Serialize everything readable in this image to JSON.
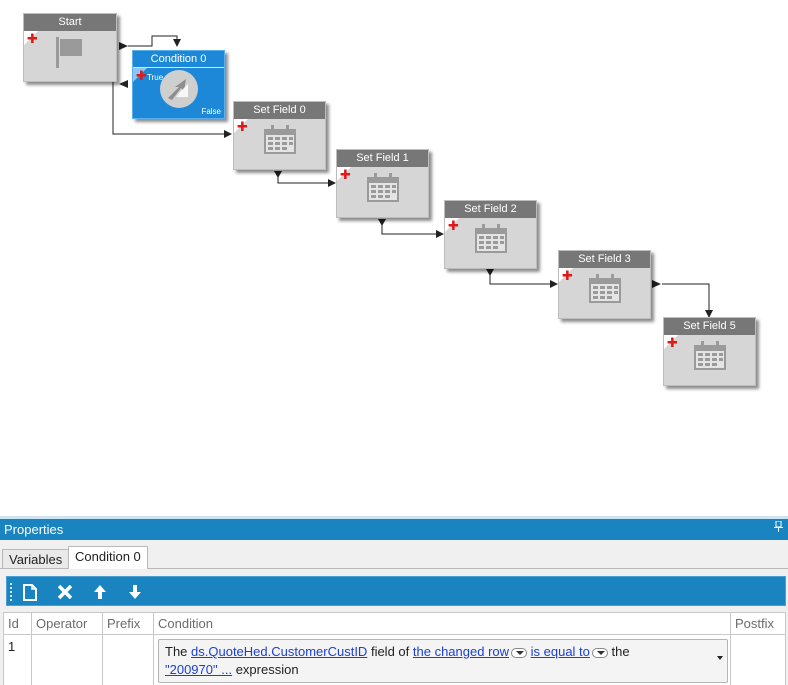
{
  "workflow": {
    "nodes": [
      {
        "id": "start",
        "title": "Start",
        "icon": "flag-icon"
      },
      {
        "id": "condition0",
        "title": "Condition 0",
        "icon": "condition-icon",
        "true_label": "True",
        "false_label": "False",
        "selected": true
      },
      {
        "id": "setfield0",
        "title": "Set Field 0",
        "icon": "calendar-icon"
      },
      {
        "id": "setfield1",
        "title": "Set Field 1",
        "icon": "calendar-icon"
      },
      {
        "id": "setfield2",
        "title": "Set Field 2",
        "icon": "calendar-icon"
      },
      {
        "id": "setfield3",
        "title": "Set Field 3",
        "icon": "calendar-icon"
      },
      {
        "id": "setfield5",
        "title": "Set Field 5",
        "icon": "calendar-icon"
      }
    ]
  },
  "properties": {
    "title": "Properties",
    "pin_icon": "pin-icon",
    "tabs": [
      {
        "label": "Variables",
        "active": false
      },
      {
        "label": "Condition 0",
        "active": true
      }
    ],
    "toolbar": {
      "new": "new-document-icon",
      "delete": "delete-x-icon",
      "move_up": "arrow-up-icon",
      "move_down": "arrow-down-icon"
    },
    "columns": [
      "Id",
      "Operator",
      "Prefix",
      "Condition",
      "Postfix"
    ],
    "rows": [
      {
        "id": "1",
        "operator": "",
        "prefix": "",
        "postfix": "",
        "condition": {
          "t1": "The",
          "field": "ds.QuoteHed.CustomerCustID",
          "t2": "field of",
          "row": "the changed row",
          "op": "is equal to",
          "t3": "the",
          "value": "\"200970\" ...",
          "t4": "expression"
        }
      }
    ]
  },
  "colors": {
    "accent": "#1a84c0",
    "selected_node": "#1e88d8",
    "node_body": "#d6d6d6",
    "node_title": "#777777",
    "add_marker": "#e01818",
    "link": "#1a3fd8"
  }
}
